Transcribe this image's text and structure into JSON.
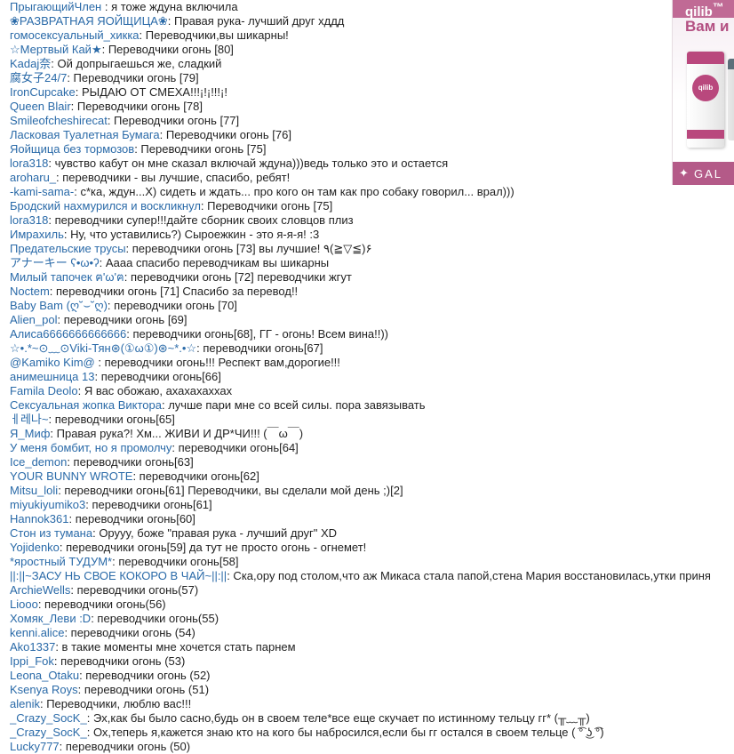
{
  "colors": {
    "nick": "#2a6aa8",
    "text": "#222222",
    "ad_brand": "#b9487d"
  },
  "ad": {
    "logo": "qilib",
    "logo_mark": "™",
    "title": "Вам и",
    "product_label": "qilib",
    "footer_icon": "star-icon",
    "footer_text": "GAL"
  },
  "messages": [
    {
      "nick": "ПрыгающийЧлен",
      "text": " : я тоже ждуна включила"
    },
    {
      "nick": "❀РАЗВРАТНАЯ ЯОЙЩИЦА❀",
      "text": ": Правая рука- лучший друг хддд"
    },
    {
      "nick": "гомосексуальный_хикка",
      "text": ": Переводчики,вы шикарны!"
    },
    {
      "nick": "☆Мертвый Кай★",
      "text": ": Переводчики огонь [80]"
    },
    {
      "nick": "Kadaj奈",
      "text": ": Ой допрыгаешься же, сладкий"
    },
    {
      "nick": "腐女子24/7",
      "text": ": Переводчики огонь [79]"
    },
    {
      "nick": "IronCupcake",
      "text": ": РЫДАЮ ОТ СМЕХА!!!¡!¡!!!¡!"
    },
    {
      "nick": "Queen Blair",
      "text": ": Переводчики огонь [78]"
    },
    {
      "nick": "Smileofcheshirecat",
      "text": ": Переводчики огонь [77]"
    },
    {
      "nick": "Ласковая Туалетная Бумага",
      "text": ": Переводчики огонь [76]"
    },
    {
      "nick": "Яойщица без тормозов",
      "text": ": Переводчики огонь [75]"
    },
    {
      "nick": "lora318",
      "text": ": чувство кабут он мне сказал включай ждуна)))ведь только это и остается"
    },
    {
      "nick": "aroharu_",
      "text": ": переводчики - вы лучшие, спасибо, ребят!"
    },
    {
      "nick": "-kami-sama-",
      "text": ": с*ка, ждун...Х) сидеть и ждать... про кого он там как про собаку говорил... врал)))"
    },
    {
      "nick": "Бродский нахмурился и воскликнул",
      "text": ": Переводчики огонь [75]"
    },
    {
      "nick": "lora318",
      "text": ": переводчики супер!!!дайте сборник своих словцов плиз"
    },
    {
      "nick": "Имрахиль",
      "text": ": Ну, что уставились?) Сыроежкин - это я-я-я! :3"
    },
    {
      "nick": "Предательские трусы",
      "text": ": переводчики огонь [73] вы лучшие! ٩(≧▽≦)۶"
    },
    {
      "nick": "アナーキー ʕ•ω•ʔ",
      "text": ": Аааа спасибо переводчикам вы шикарны"
    },
    {
      "nick": "Милый тапочек ฅ'ω'ฅ",
      "text": ": переводчики огонь [72] переводчики жгут"
    },
    {
      "nick": "Noctem",
      "text": ": переводчики огонь [71] Спасибо за перевод!!"
    },
    {
      "nick": "Baby Bam (ღ˘⌣˘ღ)",
      "text": ": переводчики огонь [70]"
    },
    {
      "nick": "Alien_pol",
      "text": ": переводчики огонь [69]"
    },
    {
      "nick": "Алиса6666666666666",
      "text": ": переводчики огонь[68], ГГ - огонь! Всем вина!!))"
    },
    {
      "nick": "☆•.*~⊙﹏⊙Viki-Тян⊛(①ω①)⊛~*.•☆",
      "text": ": переводчики огонь[67]"
    },
    {
      "nick": "@Kamiko Kim@",
      "text": " : переводчики огонь!!! Респект вам,дорогие!!!"
    },
    {
      "nick": "анимешница 13",
      "text": ": переводчики огонь[66]"
    },
    {
      "nick": "Famila Deolo",
      "text": ": Я вас обожаю, ахахахаххах"
    },
    {
      "nick": "Сексуальная жопка Виктора",
      "text": ": лучше пари мне со всей силы. пора завязывать"
    },
    {
      "nick": "ㅔ레나~",
      "text": ": переводчики огонь[65]"
    },
    {
      "nick": "Я_Миф",
      "text": ": Правая рука?! Хм... ЖИВИ И ДР*ЧИ!!! (￣ω￣)"
    },
    {
      "nick": "У меня бомбит, но я промолчу",
      "text": ": переводчики огонь[64]"
    },
    {
      "nick": "Ice_demon",
      "text": ": переводчики огонь[63]"
    },
    {
      "nick": "YOUR BUNNY WROTE",
      "text": ": переводчики огонь[62]"
    },
    {
      "nick": "Mitsu_loli",
      "text": ": переводчики огонь[61] Переводчики, вы сделали мой день ;)[2]"
    },
    {
      "nick": "miyukiyumiko3",
      "text": ": переводчики огонь[61]"
    },
    {
      "nick": "Hannok361",
      "text": ": переводчики огонь[60]"
    },
    {
      "nick": "Стон из тумана",
      "text": ": Оруyy, боже \"правая рука - лучший друг\" XD"
    },
    {
      "nick": "Yojidenko",
      "text": ": переводчики огонь[59] да тут не просто огонь - огнемет!"
    },
    {
      "nick": "*яростный ТУДУМ*",
      "text": ": переводчики огонь[58]"
    },
    {
      "nick": "||:||~ЗАСУ НЬ СВОЕ КОКОРО В ЧАЙ~||:||",
      "text": ": Ска,ору под столом,что аж Микаса стала папой,стена Мария восстановилась,утки приня"
    },
    {
      "nick": "ArchieWells",
      "text": ": переводчики огонь(57)"
    },
    {
      "nick": "Liooo",
      "text": ": переводчики огонь(56)"
    },
    {
      "nick": "Хомяк_Леви :D",
      "text": ": переводчики огонь(55)"
    },
    {
      "nick": "kenni.alice",
      "text": ": переводчики огонь (54)"
    },
    {
      "nick": "Ako1337",
      "text": ": в такие моменты мне хочется стать парнем"
    },
    {
      "nick": "Ippi_Fok",
      "text": ": переводчики огонь (53)"
    },
    {
      "nick": "Leona_Otaku",
      "text": ": переводчики огонь (52)"
    },
    {
      "nick": "Ksenya Roys",
      "text": ": переводчики огонь (51)"
    },
    {
      "nick": "alenik",
      "text": ": Переводчики, люблю вас!!!"
    },
    {
      "nick": "_Crazy_SocK_",
      "text": ": Эх,как бы было сасно,будь он в своем теле*все еще скучает по истинному тельцу гг* (╥﹏╥)"
    },
    {
      "nick": "_Crazy_SocK_",
      "text": ": Ох,теперь я,кажется знаю кто на кого бы набросился,если бы гг остался в своем тельце ( ͡° ͜ʖ ͡°)"
    },
    {
      "nick": "Lucky777",
      "text": ": переводчики огонь (50)"
    }
  ]
}
